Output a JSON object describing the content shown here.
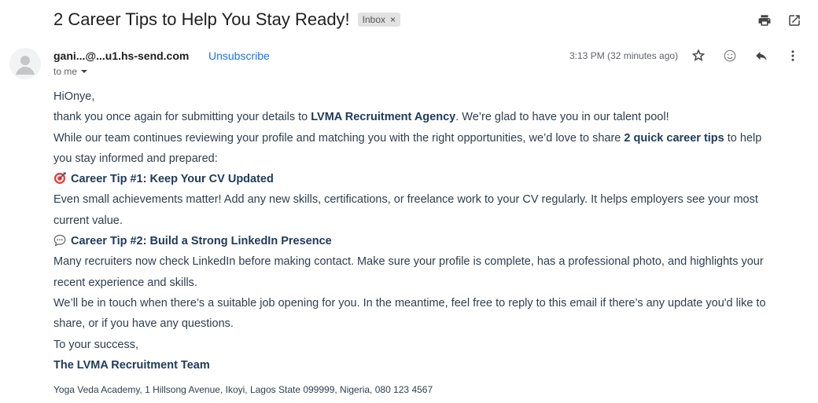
{
  "email": {
    "subject": "2 Career Tips to Help You Stay Ready!",
    "label_chip": "Inbox",
    "label_chip_close": "×",
    "sender": "gani...@...u1.hs-send.com",
    "unsubscribe": "Unsubscribe",
    "to_line": "to me",
    "timestamp": "3:13 PM (32 minutes ago)"
  },
  "body": {
    "greeting": "HiOnye,",
    "p1_start": "thank you once again for submitting your details to ",
    "p1_bold": "LVMA Recruitment Agency",
    "p1_end": ". We’re glad to have you in our talent pool!",
    "p2_start": "While our team continues reviewing your profile and matching you with the right opportunities, we’d love to share ",
    "p2_bold": "2 quick career tips",
    "p2_end": " to help",
    "p2_line2": "you stay informed and prepared:",
    "tip1_title": "Career Tip #1: Keep Your CV Updated",
    "tip1_line1": "Even small achievements matter! Add any new skills, certifications, or freelance work to your CV regularly. It helps employers see your most",
    "tip1_line2": "current value.",
    "tip2_title": "Career Tip #2: Build a Strong LinkedIn Presence",
    "tip2_line1": "Many recruiters now check LinkedIn before making contact. Make sure your profile is complete, has a professional photo, and highlights your",
    "tip2_line2": "recent experience and skills.",
    "closing_line1": "We’ll be in touch when there’s a suitable job opening for you. In the meantime, feel free to reply to this email if there’s any update you'd like to",
    "closing_line2": "share, or if you have any questions.",
    "signoff": "To your success,",
    "signature": "The LVMA Recruitment Team"
  },
  "footer": {
    "address": "Yoga Veda Academy, 1 Hillsong Avenue, Ikoyi, Lagos State 099999, Nigeria, 080 123 4567"
  },
  "icons": {
    "print": "print-icon",
    "open_new_window": "open-in-new-window-icon",
    "star": "star-icon",
    "emoji": "emoji-reaction-icon",
    "reply": "reply-icon",
    "more": "more-vertical-icon",
    "dropdown": "chevron-down-icon",
    "tip1": "target-emoji-icon",
    "tip2": "speech-bubble-emoji-icon"
  },
  "colors": {
    "link": "#1a73e8",
    "body_text": "#2f3e4e",
    "bold_text": "#1f3a5a"
  }
}
